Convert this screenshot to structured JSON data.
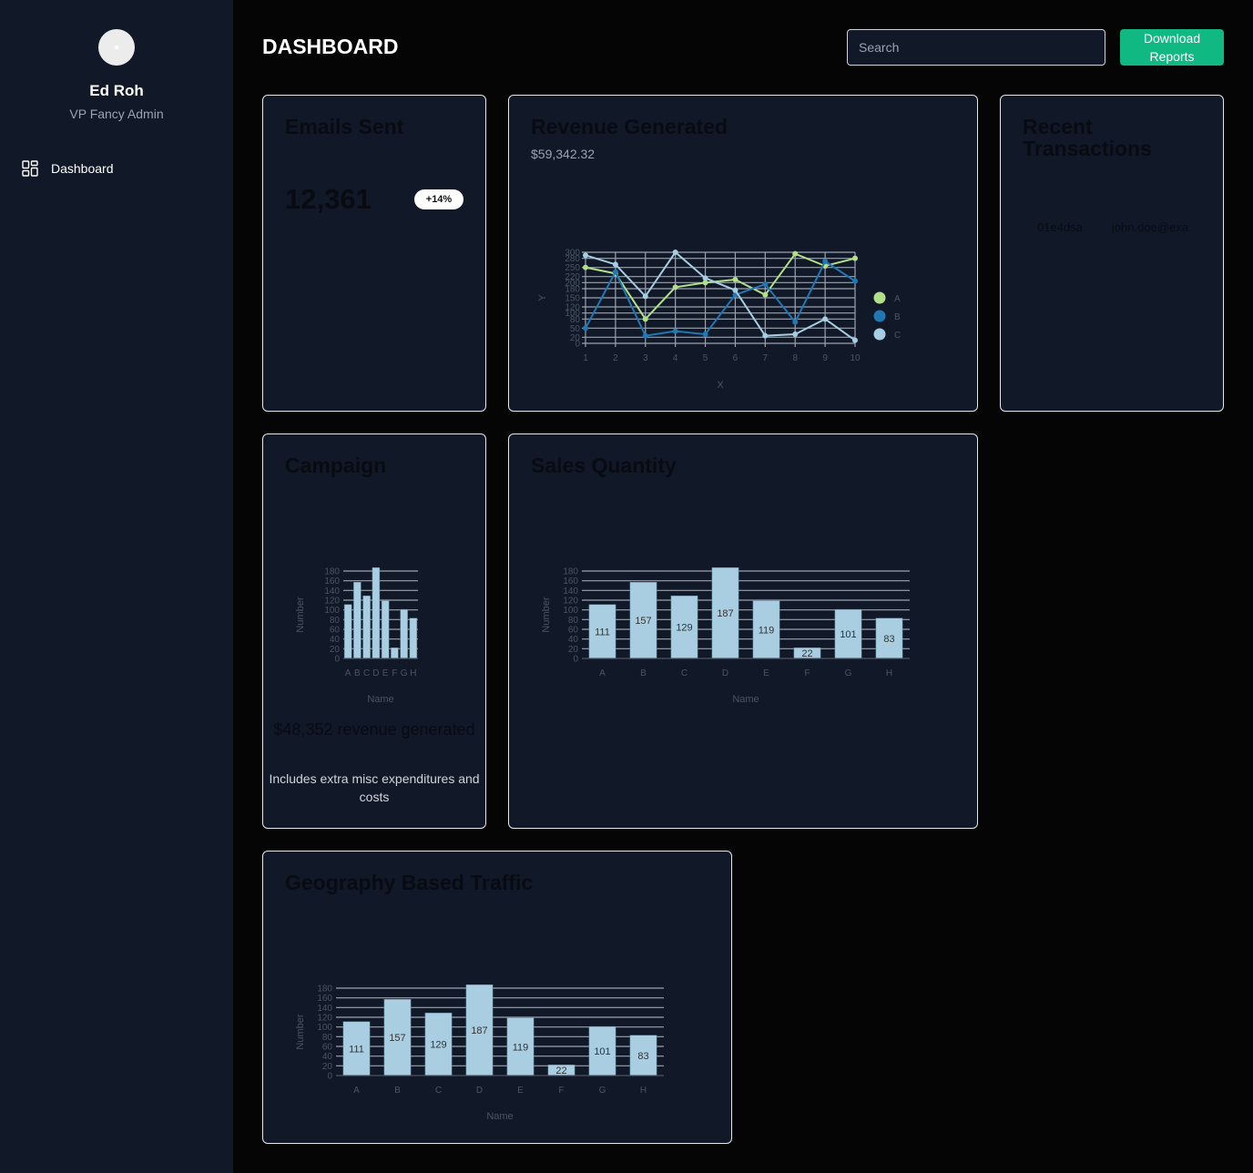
{
  "sidebar": {
    "user": {
      "name": "Ed Roh",
      "role": "VP Fancy Admin"
    },
    "nav": [
      {
        "label": "Dashboard",
        "icon": "dashboard-grid-icon"
      }
    ]
  },
  "header": {
    "title": "DASHBOARD",
    "search_placeholder": "Search",
    "download_label": "Download Reports"
  },
  "cards": {
    "emails": {
      "title": "Emails Sent",
      "value": "12,361",
      "change": "+14%"
    },
    "revenue": {
      "title": "Revenue Generated",
      "value": "$59,342.32"
    },
    "transactions": {
      "title": "Recent Transactions",
      "rows": [
        {
          "id": "01e4dsa",
          "user": "john.doe@exa"
        }
      ]
    },
    "campaign": {
      "title": "Campaign",
      "revenue_text": "$48,352 revenue generated",
      "note": "Includes extra misc expenditures and costs"
    },
    "sales": {
      "title": "Sales Quantity"
    },
    "geo": {
      "title": "Geography Based Traffic"
    }
  },
  "colors": {
    "accent": "#10b981",
    "bar": "#a9cee1",
    "seriesA": "#b2df8a",
    "seriesB": "#1f78b4",
    "seriesC": "#a6cee3"
  },
  "chart_data": [
    {
      "id": "revenue-line",
      "type": "line",
      "x": [
        1,
        2,
        3,
        4,
        5,
        6,
        7,
        8,
        9,
        10
      ],
      "series": [
        {
          "name": "A",
          "values": [
            250,
            230,
            80,
            185,
            200,
            210,
            160,
            295,
            255,
            280
          ]
        },
        {
          "name": "B",
          "values": [
            50,
            235,
            25,
            40,
            30,
            160,
            195,
            70,
            270,
            205
          ]
        },
        {
          "name": "C",
          "values": [
            290,
            260,
            155,
            300,
            215,
            175,
            25,
            30,
            80,
            10
          ]
        }
      ],
      "xlabel": "X",
      "ylabel": "Y",
      "ylim": [
        0,
        300
      ],
      "yticks": [
        0,
        20,
        50,
        80,
        100,
        120,
        150,
        180,
        200,
        220,
        250,
        280,
        300
      ],
      "legend_position": "right",
      "grid": true
    },
    {
      "id": "campaign-bar",
      "type": "bar",
      "categories": [
        "A",
        "B",
        "C",
        "D",
        "E",
        "F",
        "G",
        "H"
      ],
      "values": [
        111,
        157,
        129,
        187,
        119,
        22,
        101,
        83
      ],
      "xlabel": "Name",
      "ylabel": "Number",
      "ylim": [
        0,
        180
      ],
      "yticks": [
        0,
        20,
        40,
        60,
        80,
        100,
        120,
        140,
        160,
        180
      ],
      "data_labels": false
    },
    {
      "id": "sales-bar",
      "type": "bar",
      "categories": [
        "A",
        "B",
        "C",
        "D",
        "E",
        "F",
        "G",
        "H"
      ],
      "values": [
        111,
        157,
        129,
        187,
        119,
        22,
        101,
        83
      ],
      "xlabel": "Name",
      "ylabel": "Number",
      "ylim": [
        0,
        180
      ],
      "yticks": [
        0,
        20,
        40,
        60,
        80,
        100,
        120,
        140,
        160,
        180
      ],
      "data_labels": true
    },
    {
      "id": "geo-bar",
      "type": "bar",
      "categories": [
        "A",
        "B",
        "C",
        "D",
        "E",
        "F",
        "G",
        "H"
      ],
      "values": [
        111,
        157,
        129,
        187,
        119,
        22,
        101,
        83
      ],
      "xlabel": "Name",
      "ylabel": "Number",
      "ylim": [
        0,
        180
      ],
      "yticks": [
        0,
        20,
        40,
        60,
        80,
        100,
        120,
        140,
        160,
        180
      ],
      "data_labels": true
    }
  ]
}
